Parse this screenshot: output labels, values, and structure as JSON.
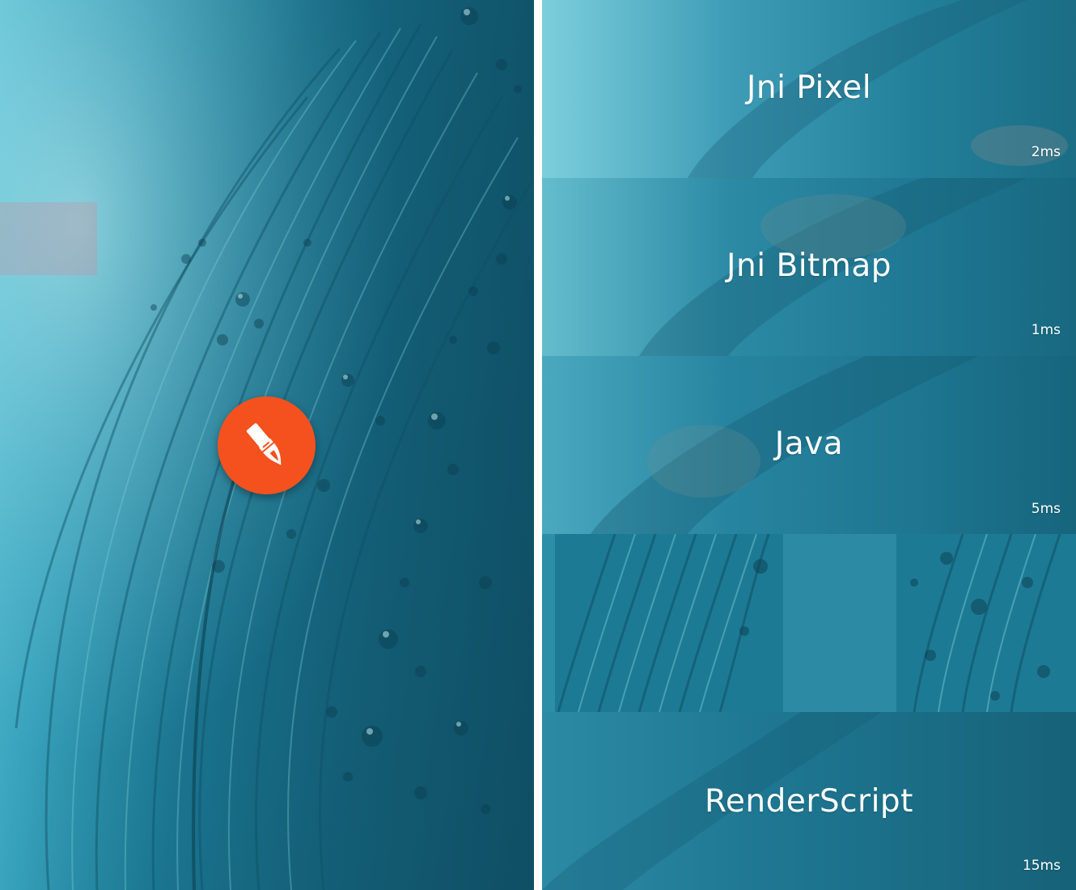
{
  "left_screen": {
    "fab": {
      "icon": "brush-icon",
      "color": "#f4511e"
    }
  },
  "right_screen": {
    "panels": [
      {
        "title": "Jni Pixel",
        "time": "2ms"
      },
      {
        "title": "Jni Bitmap",
        "time": "1ms"
      },
      {
        "title": "Java",
        "time": "5ms"
      },
      {
        "title": "",
        "time": ""
      },
      {
        "title": "RenderScript",
        "time": "15ms"
      }
    ]
  },
  "colors": {
    "accent": "#f4511e",
    "feather_teal": "#1d7c97",
    "text": "#ffffff"
  }
}
